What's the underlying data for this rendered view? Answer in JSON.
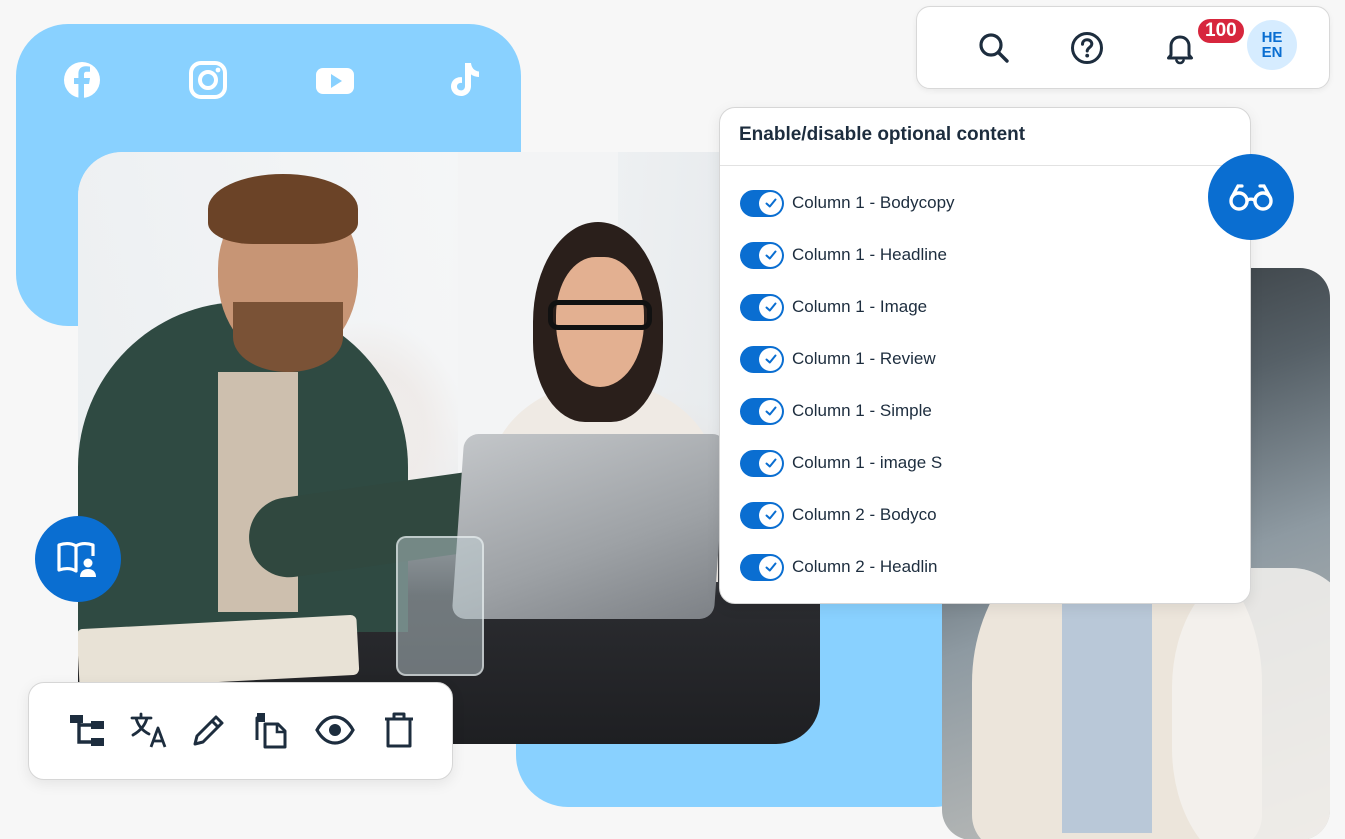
{
  "colors": {
    "brand_blue": "#0a6ed1",
    "card_blue": "#89d1ff",
    "badge_red": "#d7263d",
    "text_dark": "#1d2d3e"
  },
  "social": {
    "icons": [
      "facebook-icon",
      "instagram-icon",
      "youtube-icon",
      "tiktok-icon"
    ]
  },
  "top_nav": {
    "icons": [
      "search-icon",
      "help-icon",
      "bell-icon"
    ],
    "notification_count": "100",
    "lang_primary": "HE",
    "lang_secondary": "EN"
  },
  "panel": {
    "title": "Enable/disable optional content",
    "items": [
      {
        "label": "Column 1 - Bodycopy",
        "enabled": true
      },
      {
        "label": "Column 1 - Headline",
        "enabled": true
      },
      {
        "label": "Column 1 - Image",
        "enabled": true
      },
      {
        "label": "Column 1 - Review",
        "enabled": true
      },
      {
        "label": "Column 1 - Simple",
        "enabled": true
      },
      {
        "label": "Column 1 - image S",
        "enabled": true
      },
      {
        "label": "Column 2 - Bodyco",
        "enabled": true
      },
      {
        "label": "Column 2 - Headlin",
        "enabled": true
      }
    ]
  },
  "floating_buttons": {
    "glasses": "glasses-icon",
    "reader": "reader-book-icon"
  },
  "toolbar": {
    "icons": [
      "structure-icon",
      "translate-icon",
      "edit-icon",
      "copy-icon",
      "preview-icon",
      "delete-icon"
    ]
  }
}
